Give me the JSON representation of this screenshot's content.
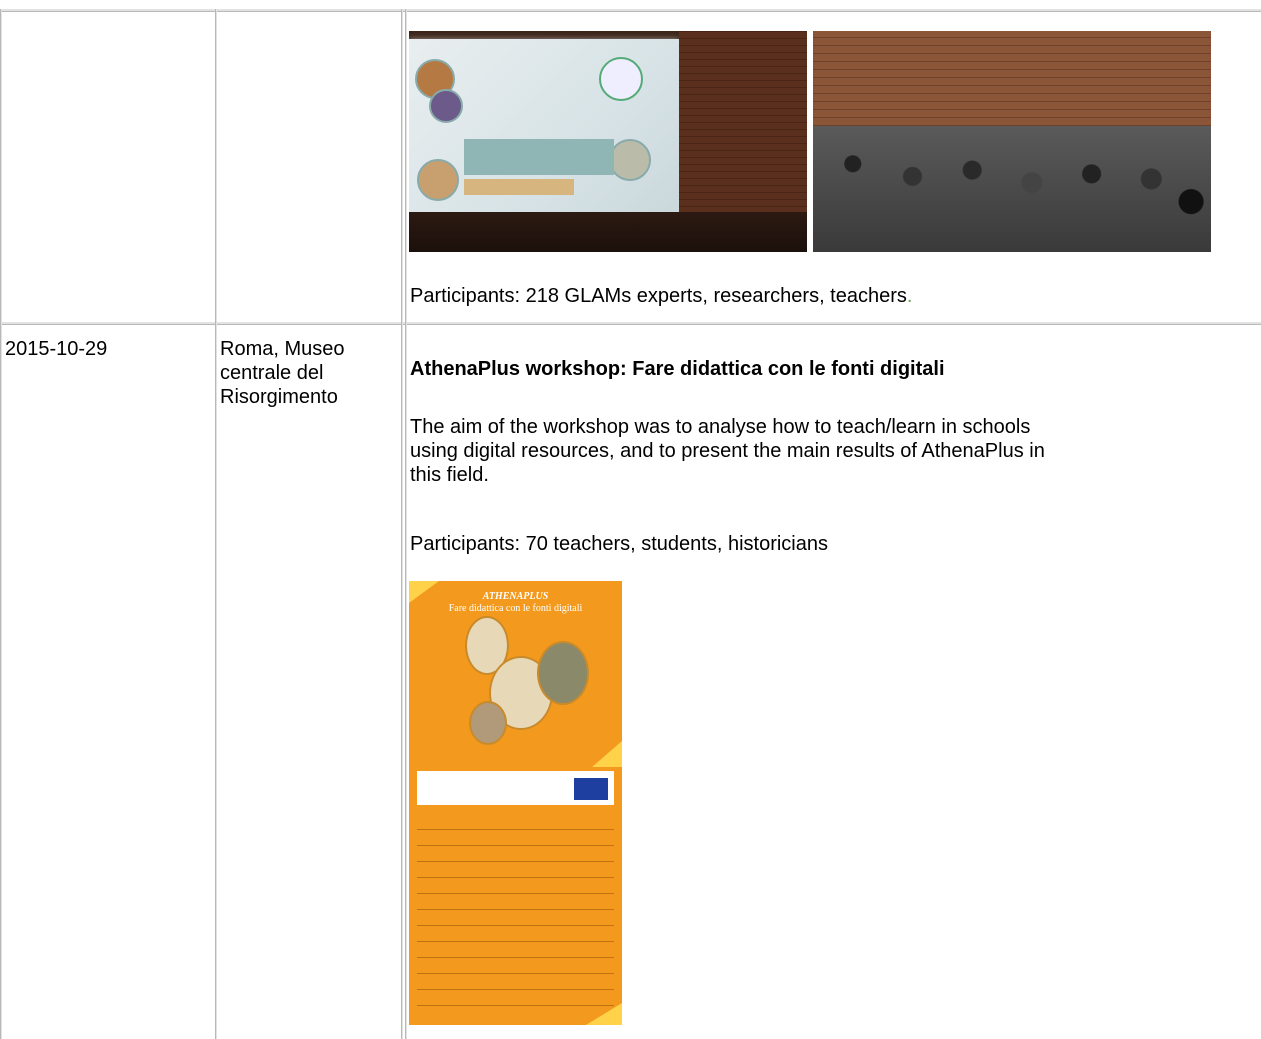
{
  "rows": [
    {
      "date": "",
      "place": "",
      "images": [
        "conference-photo",
        "audience-photo"
      ],
      "participants_text": "Participants: 218 GLAMs experts, researchers, teachers",
      "participants_trailing": "."
    },
    {
      "date": "2015-10-29",
      "place_lines": [
        "Roma, Museo",
        "centrale del",
        "Risorgimento"
      ],
      "title": "AthenaPlus workshop: Fare didattica con le fonti digitali",
      "description_lines": [
        "The aim of the workshop was to analyse how to teach/learn in schools",
        "using digital resources, and to present the main results of AthenaPlus in",
        "this field."
      ],
      "participants_text": "Participants: 70 teachers, students, historicians",
      "poster": {
        "title_line1": "ATHENAPLUS",
        "title_line2": "Fare didattica con le fonti digitali"
      }
    }
  ],
  "colors": {
    "grid": "#b8b8b8",
    "poster_orange": "#f39a1e",
    "trailing_dot": "#6aa84f"
  }
}
